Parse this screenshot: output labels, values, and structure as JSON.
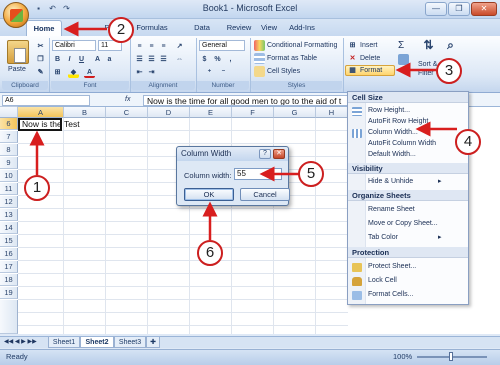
{
  "window": {
    "title": "Book1 - Microsoft Excel",
    "qat": [
      "save-icon",
      "undo-icon",
      "redo-icon"
    ],
    "controls": [
      "—",
      "❐",
      "✕"
    ]
  },
  "tabs": [
    "Home",
    "Insert",
    "Page Layout",
    "Formulas",
    "Data",
    "Review",
    "View",
    "Add-Ins"
  ],
  "tabs_visible_text": [
    "Home",
    "Pac",
    "Formulas",
    "Data",
    "Review",
    "View",
    "Add-Ins"
  ],
  "ribbon": {
    "clipboard": {
      "label": "Clipboard",
      "paste": "Paste"
    },
    "font": {
      "label": "Font",
      "name": "Calibri",
      "size": "11",
      "bold": "B",
      "italic": "I",
      "underline": "U"
    },
    "alignment": {
      "label": "Alignment"
    },
    "number": {
      "label": "Number",
      "format": "General",
      "currency": "$",
      "percent": "%",
      "comma": ","
    },
    "styles": {
      "label": "Styles",
      "conditional": "Conditional Formatting",
      "table": "Format as Table",
      "cell_styles": "Cell Styles"
    },
    "cells": {
      "insert": "Insert",
      "delete": "Delete",
      "format": "Format"
    },
    "editing": {
      "sigma": "Σ",
      "sort": "Sort &",
      "filter": "Filter"
    }
  },
  "formula_bar": {
    "name_box": "A6",
    "fx": "fx",
    "content": "Now is the time for all good men to go to the aid of t"
  },
  "grid": {
    "columns": [
      "A",
      "B",
      "C",
      "D",
      "E",
      "F",
      "G",
      "H"
    ],
    "rows": [
      "5",
      "6",
      "7",
      "8",
      "9",
      "10",
      "11",
      "12",
      "13",
      "14",
      "15",
      "16",
      "17",
      "18",
      "19"
    ],
    "cell_a6": "Now is the time for all good men to go to the aid of their country.",
    "cell_b6": "Test"
  },
  "sheets": [
    "Sheet1",
    "Sheet2",
    "Sheet3"
  ],
  "status": {
    "ready": "Ready",
    "zoom": "100%"
  },
  "format_menu": {
    "section_cell_size": "Cell Size",
    "row_height": "Row Height...",
    "autofit_row": "AutoFit Row Height",
    "column_width": "Column Width...",
    "autofit_column": "AutoFit Column Width",
    "default_width": "Default Width...",
    "section_visibility": "Visibility",
    "hide_unhide": "Hide & Unhide",
    "section_organize": "Organize Sheets",
    "rename": "Rename Sheet",
    "move_copy": "Move or Copy Sheet...",
    "tab_color": "Tab Color",
    "section_protection": "Protection",
    "protect": "Protect Sheet...",
    "lock": "Lock Cell",
    "format_cells": "Format Cells..."
  },
  "dialog": {
    "title": "Column Width",
    "help": "?",
    "close": "✕",
    "label": "Column width:",
    "value": "55",
    "ok": "OK",
    "cancel": "Cancel"
  },
  "callouts": [
    "1",
    "2",
    "3",
    "4",
    "5",
    "6"
  ],
  "colors": {
    "callout_red": "#cc1f1f",
    "arrow_red": "#d81e1e",
    "ribbon_blue": "#dde8f6"
  }
}
